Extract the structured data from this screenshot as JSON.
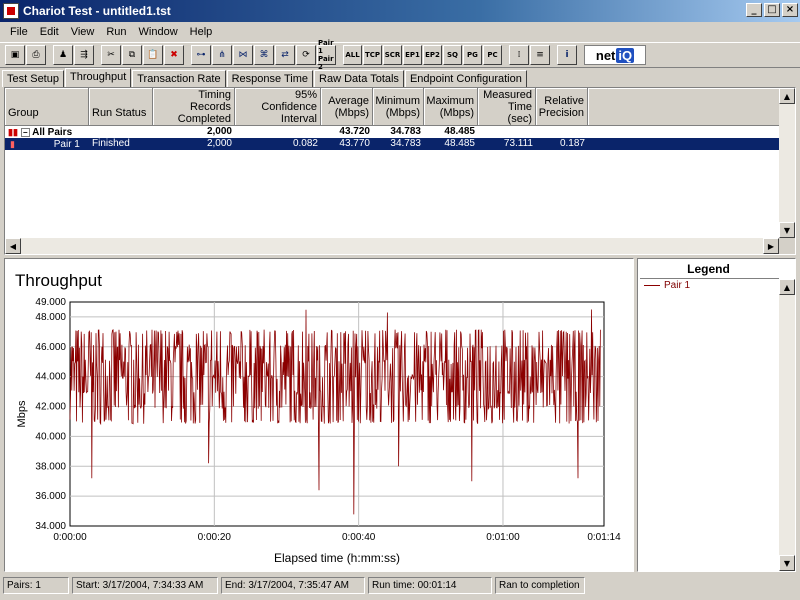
{
  "window": {
    "title": "Chariot Test - untitled1.tst",
    "controls": [
      "_",
      "□",
      "×"
    ]
  },
  "menu": [
    "File",
    "Edit",
    "View",
    "Run",
    "Window",
    "Help"
  ],
  "toolbar": {
    "text_buttons": [
      "ALL",
      "TCP",
      "SCR",
      "EP1",
      "EP2",
      "SQ",
      "PG",
      "PC"
    ],
    "pair_button": [
      "Pair 1",
      "Pair 2"
    ],
    "logo_text": "net",
    "logo_highlight": "iQ"
  },
  "tabs": [
    "Test Setup",
    "Throughput",
    "Transaction Rate",
    "Response Time",
    "Raw Data Totals",
    "Endpoint Configuration"
  ],
  "active_tab": "Throughput",
  "grid": {
    "columns": [
      {
        "label1": "",
        "label2": "Group"
      },
      {
        "label1": "",
        "label2": "Run Status"
      },
      {
        "label1": "Timing Records",
        "label2": "Completed"
      },
      {
        "label1": "95% Confidence",
        "label2": "Interval"
      },
      {
        "label1": "Average",
        "label2": "(Mbps)"
      },
      {
        "label1": "Minimum",
        "label2": "(Mbps)"
      },
      {
        "label1": "Maximum",
        "label2": "(Mbps)"
      },
      {
        "label1": "Measured",
        "label2": "Time (sec)"
      },
      {
        "label1": "Relative",
        "label2": "Precision"
      }
    ],
    "rows": [
      {
        "group": "All Pairs",
        "status": "",
        "records": "2,000",
        "ci": "",
        "avg": "43.720",
        "min": "34.783",
        "max": "48.485",
        "time": "",
        "precision": ""
      },
      {
        "group": "Pair 1",
        "status": "Finished",
        "records": "2,000",
        "ci": "0.082",
        "avg": "43.770",
        "min": "34.783",
        "max": "48.485",
        "time": "73.111",
        "precision": "0.187"
      }
    ]
  },
  "chart": {
    "title": "Throughput",
    "legend_title": "Legend"
  },
  "chart_data": {
    "type": "line",
    "title": "Throughput",
    "xlabel": "Elapsed time (h:mm:ss)",
    "ylabel": "Mbps",
    "xlim": [
      0,
      74
    ],
    "ylim": [
      34,
      49
    ],
    "x_ticks": [
      "0:00:00",
      "0:00:20",
      "0:00:40",
      "0:01:00",
      "0:01:14"
    ],
    "y_ticks": [
      "34.000",
      "36.000",
      "38.000",
      "40.000",
      "42.000",
      "44.000",
      "46.000",
      "48.000",
      "49.000"
    ],
    "grid": true,
    "series": [
      {
        "name": "Pair 1",
        "color": "#8b0000",
        "mean": 43.77,
        "min": 34.783,
        "max": 48.485,
        "points": 2000,
        "dips": [
          {
            "x": 3.0,
            "y": 37.2
          },
          {
            "x": 19.2,
            "y": 38.2
          },
          {
            "x": 34.5,
            "y": 36.4
          },
          {
            "x": 39.3,
            "y": 34.78
          },
          {
            "x": 45.5,
            "y": 38.0
          },
          {
            "x": 55.7,
            "y": 37.0
          },
          {
            "x": 70.4,
            "y": 37.2
          }
        ],
        "peaks": [
          {
            "x": 32.7,
            "y": 48.48
          },
          {
            "x": 44.0,
            "y": 48.3
          },
          {
            "x": 72.3,
            "y": 48.5
          }
        ]
      }
    ]
  },
  "status_bar": {
    "pairs": "Pairs: 1",
    "start": "Start: 3/17/2004, 7:34:33 AM",
    "end": "End: 3/17/2004, 7:35:47 AM",
    "run_time": "Run time: 00:01:14",
    "status": "Ran to completion"
  }
}
